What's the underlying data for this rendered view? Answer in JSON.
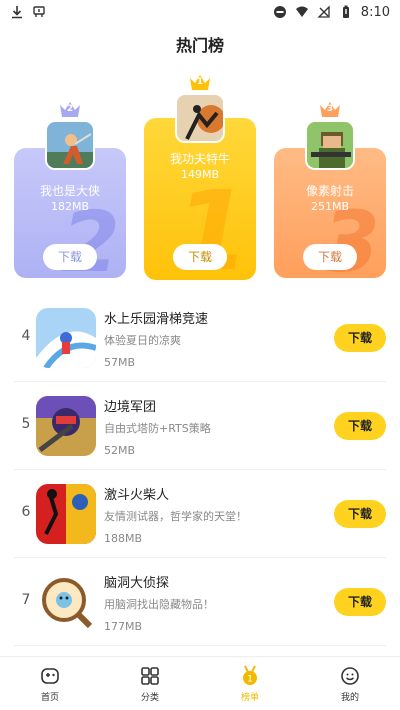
{
  "status_bar": {
    "time": "8:10"
  },
  "page_title": "热门榜",
  "podium": [
    {
      "rank": "2",
      "name": "我也是大侠",
      "size": "182MB",
      "download_label": "下载",
      "accent": "#b6b8f5",
      "btn_text_color": "#9aa0d8"
    },
    {
      "rank": "1",
      "name": "我功夫特牛",
      "size": "149MB",
      "download_label": "下载",
      "accent": "#ffca1a",
      "btn_text_color": "#c99600"
    },
    {
      "rank": "3",
      "name": "像素射击",
      "size": "251MB",
      "download_label": "下载",
      "accent": "#ffab6b",
      "btn_text_color": "#d9824c"
    }
  ],
  "list": [
    {
      "rank": "4",
      "name": "水上乐园滑梯竞速",
      "desc": "体验夏日的凉爽",
      "size": "57MB",
      "download_label": "下载"
    },
    {
      "rank": "5",
      "name": "边境军团",
      "desc": "自由式塔防+RTS策略",
      "size": "52MB",
      "download_label": "下载"
    },
    {
      "rank": "6",
      "name": "激斗火柴人",
      "desc": "友情测试器，哲学家的天堂！",
      "size": "188MB",
      "download_label": "下载"
    },
    {
      "rank": "7",
      "name": "脑洞大侦探",
      "desc": "用脑洞找出隐藏物品！",
      "size": "177MB",
      "download_label": "下载"
    }
  ],
  "bottom_nav": [
    {
      "label": "首页",
      "icon": "gamepad-icon"
    },
    {
      "label": "分类",
      "icon": "grid-icon"
    },
    {
      "label": "榜单",
      "icon": "medal-icon",
      "active": true
    },
    {
      "label": "我的",
      "icon": "smile-icon"
    }
  ],
  "colors": {
    "accent_yellow": "#ffd21f",
    "active_nav": "#f3b800"
  }
}
